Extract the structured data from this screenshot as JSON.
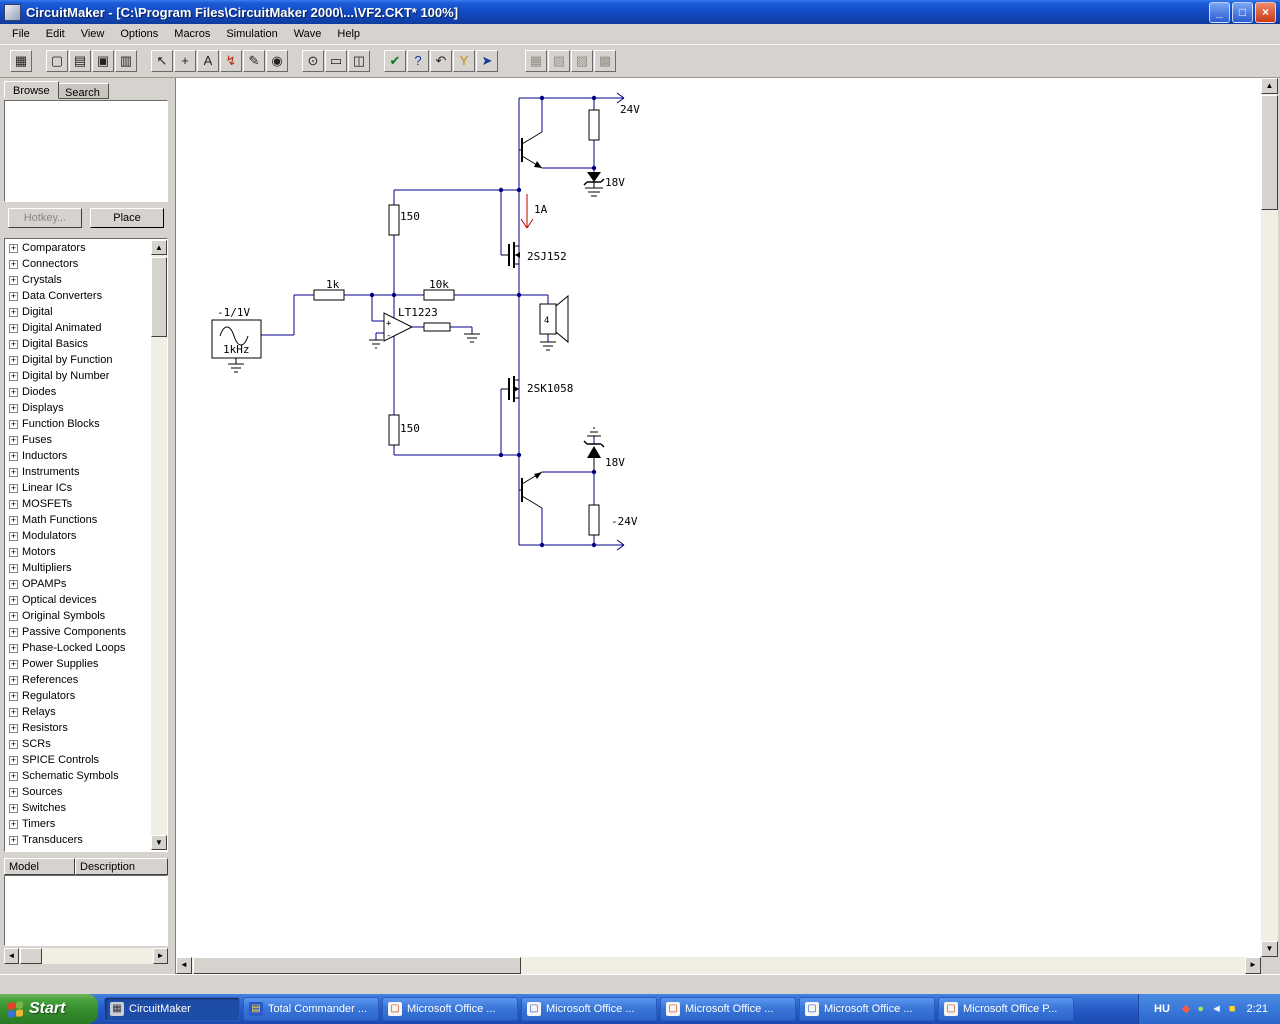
{
  "window": {
    "title": "CircuitMaker - [C:\\Program Files\\CircuitMaker 2000\\...\\VF2.CKT* 100%]",
    "minimize_icon": "_",
    "restore_icon": "□",
    "close_icon": "×"
  },
  "menu": [
    "File",
    "Edit",
    "View",
    "Options",
    "Macros",
    "Simulation",
    "Wave",
    "Help"
  ],
  "toolbar": {
    "buttons": [
      {
        "name": "browse",
        "glyph": "▦"
      },
      {
        "name": "new",
        "glyph": "▢"
      },
      {
        "name": "open",
        "glyph": "▤"
      },
      {
        "name": "save",
        "glyph": "▣"
      },
      {
        "name": "print",
        "glyph": "▥"
      },
      {
        "name": "select",
        "glyph": "↖"
      },
      {
        "name": "place-plus",
        "glyph": "+"
      },
      {
        "name": "text",
        "glyph": "A"
      },
      {
        "name": "wire",
        "glyph": "↯"
      },
      {
        "name": "probe",
        "glyph": "✎"
      },
      {
        "name": "zoom",
        "glyph": "◉"
      },
      {
        "name": "find",
        "glyph": "⊙"
      },
      {
        "name": "sheet",
        "glyph": "▭"
      },
      {
        "name": "split",
        "glyph": "◫"
      },
      {
        "name": "simulation-mode",
        "glyph": "✔"
      },
      {
        "name": "help",
        "glyph": "?"
      },
      {
        "name": "reset",
        "glyph": "↶"
      },
      {
        "name": "probe-y",
        "glyph": "Y"
      },
      {
        "name": "run",
        "glyph": "➤"
      },
      {
        "name": "scope",
        "glyph": "▦"
      },
      {
        "name": "meter",
        "glyph": "▧"
      },
      {
        "name": "generator",
        "glyph": "▨"
      },
      {
        "name": "analyzer",
        "glyph": "▩"
      }
    ]
  },
  "sidebar": {
    "tabs": [
      {
        "label": "Browse"
      },
      {
        "label": "Search"
      }
    ],
    "hotkey_button": "Hotkey...",
    "place_button": "Place",
    "expander": "+",
    "categories": [
      "Comparators",
      "Connectors",
      "Crystals",
      "Data Converters",
      "Digital",
      "Digital Animated",
      "Digital Basics",
      "Digital by Function",
      "Digital by Number",
      "Diodes",
      "Displays",
      "Function Blocks",
      "Fuses",
      "Inductors",
      "Instruments",
      "Linear ICs",
      "MOSFETs",
      "Math Functions",
      "Modulators",
      "Motors",
      "Multipliers",
      "OPAMPs",
      "Optical devices",
      "Original Symbols",
      "Passive Components",
      "Phase-Locked Loops",
      "Power Supplies",
      "References",
      "Regulators",
      "Relays",
      "Resistors",
      "SCRs",
      "SPICE Controls",
      "Schematic Symbols",
      "Sources",
      "Switches",
      "Timers",
      "Transducers"
    ],
    "model_header": "Model",
    "description_header": "Description"
  },
  "schematic": {
    "labels": {
      "vplus": "24V",
      "zener_top": "18V",
      "current": "1A",
      "mosfet_top": "2SJ152",
      "r_gate_top": "150",
      "r_in": "1k",
      "r_fb": "10k",
      "opamp": "LT1223",
      "src_amp": "-1/1V",
      "src_freq": "1kHz",
      "load": "4",
      "mosfet_bot": "2SK1058",
      "r_gate_bot": "150",
      "zener_bot": "18V",
      "vminus": "-24V",
      "plus": "+",
      "minus": "-"
    }
  },
  "taskbar": {
    "start": "Start",
    "tasks": [
      {
        "label": "CircuitMaker"
      },
      {
        "label": "Total Commander ..."
      },
      {
        "label": "Microsoft Office ..."
      },
      {
        "label": "Microsoft Office ..."
      },
      {
        "label": "Microsoft Office ..."
      },
      {
        "label": "Microsoft Office ..."
      },
      {
        "label": "Microsoft Office P..."
      }
    ],
    "language": "HU",
    "clock": "2:21"
  }
}
